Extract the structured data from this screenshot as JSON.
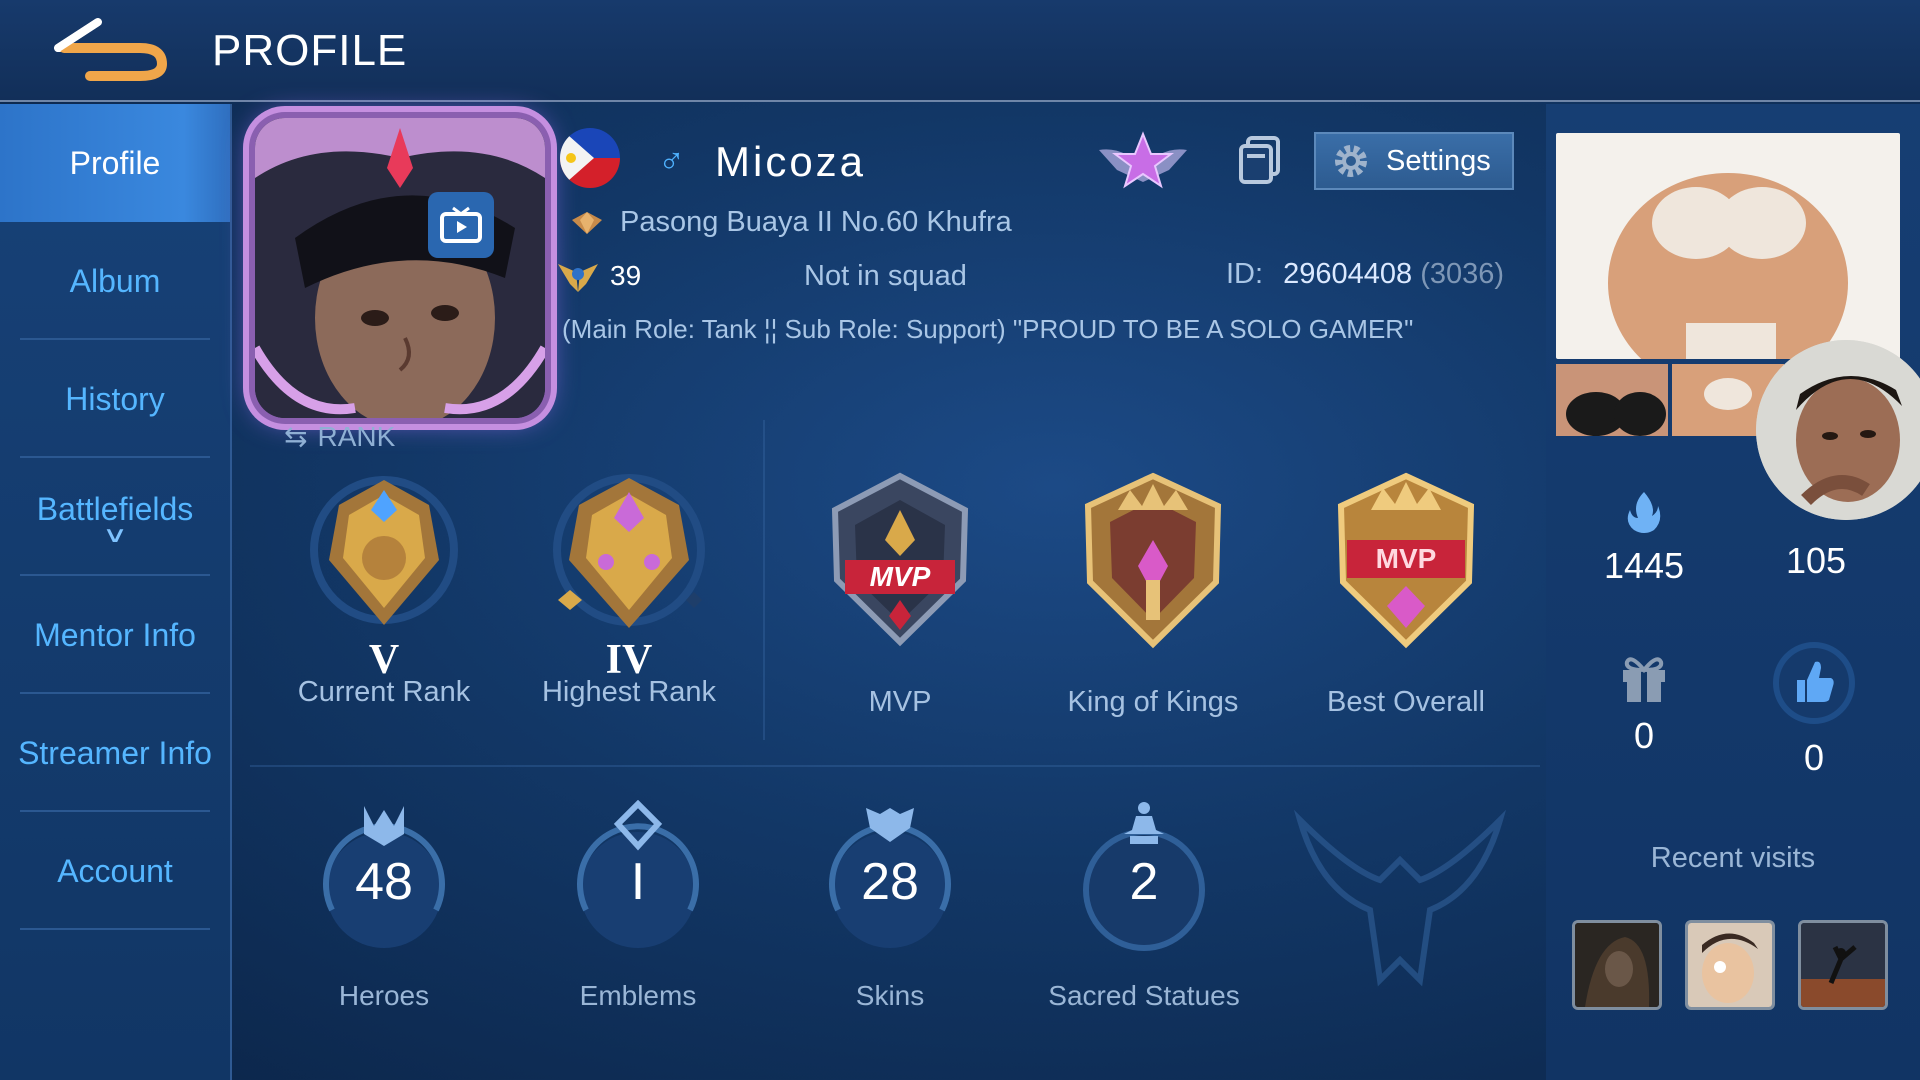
{
  "header": {
    "title": "PROFILE"
  },
  "sidebar": {
    "items": [
      {
        "label": "Profile",
        "active": true
      },
      {
        "label": "Album"
      },
      {
        "label": "History"
      },
      {
        "label": "Battlefields",
        "expandable": true
      },
      {
        "label": "Mentor Info"
      },
      {
        "label": "Streamer Info"
      },
      {
        "label": "Account"
      }
    ]
  },
  "profile": {
    "name": "Micoza",
    "gender_symbol": "♂",
    "location": "Pasong Buaya II No.60 Khufra",
    "level": "39",
    "squad": "Not in squad",
    "id_label": "ID:",
    "id": "29604408",
    "server": "(3036)",
    "bio": "(Main Role: Tank ¦¦ Sub Role: Support) \"PROUD TO BE A SOLO GAMER\"",
    "rank_caption": "RANK",
    "settings_label": "Settings"
  },
  "badges": [
    {
      "roman": "V",
      "label": "Current Rank"
    },
    {
      "roman": "IV",
      "label": "Highest Rank"
    },
    {
      "roman": "",
      "label": "MVP"
    },
    {
      "roman": "",
      "label": "King of Kings"
    },
    {
      "roman": "",
      "label": "Best Overall"
    }
  ],
  "stats": [
    {
      "value": "48",
      "label": "Heroes"
    },
    {
      "value": "I",
      "label": "Emblems"
    },
    {
      "value": "28",
      "label": "Skins"
    },
    {
      "value": "2",
      "label": "Sacred Statues"
    }
  ],
  "right_panel": {
    "popularity": "1445",
    "followers": "105",
    "gifts": "0",
    "likes": "0",
    "recent_visits_label": "Recent visits"
  },
  "colors": {
    "accent": "#55b6ff",
    "active_tab": "#3a88de",
    "gold": "#d9a94a"
  }
}
